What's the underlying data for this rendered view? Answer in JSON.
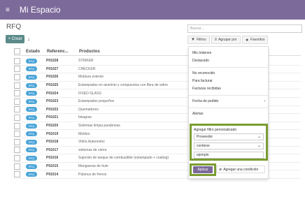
{
  "app": {
    "menu_icon": "≡",
    "title": "Mi Espacio"
  },
  "page": {
    "title": "RFQ"
  },
  "toolbar": {
    "create_label": "+ Crear",
    "download_icon": "↓"
  },
  "search": {
    "placeholder": "Buscar..."
  },
  "filters_bar": {
    "filters_label": "Filtros",
    "group_label": "Agrupar por",
    "favorites_label": "Favoritos"
  },
  "table": {
    "headers": [
      "Estado",
      "Referenc...",
      "Productos"
    ],
    "rows": [
      {
        "estado": "RFQ",
        "ref": "P01028",
        "product": "STRIKER"
      },
      {
        "estado": "RFQ",
        "ref": "P01027",
        "product": "CHECKER"
      },
      {
        "estado": "RFQ",
        "ref": "P01026",
        "product": "Moldura exterior"
      },
      {
        "estado": "RFQ",
        "ref": "P01025",
        "product": "Estampados en aluminio y compuestos con fibra de vidrio"
      },
      {
        "estado": "RFQ",
        "ref": "P01024",
        "product": "FIXED GLASS"
      },
      {
        "estado": "RFQ",
        "ref": "P01023",
        "product": "Estampados pequeños"
      },
      {
        "estado": "RFQ",
        "ref": "P01022",
        "product": "Quemadores"
      },
      {
        "estado": "RFQ",
        "ref": "P01021",
        "product": "bisagras"
      },
      {
        "estado": "RFQ",
        "ref": "P01020",
        "product": "Sistemas limpia parabrisas"
      },
      {
        "estado": "RFQ",
        "ref": "P01019",
        "product": "Moldeo"
      },
      {
        "estado": "RFQ",
        "ref": "P01018",
        "product": "Vidrio Automotriz"
      },
      {
        "estado": "RFQ",
        "ref": "P01017",
        "product": "sistemas de cierre"
      },
      {
        "estado": "RFQ",
        "ref": "P01016",
        "product": "Sujeción de tanque de combustible (estampado + coating)"
      },
      {
        "estado": "RFQ",
        "ref": "P01015",
        "product": "Mangueras de hule"
      },
      {
        "estado": "RFQ",
        "ref": "P01014",
        "product": "Palanca de frenos"
      }
    ]
  },
  "filter_menu": {
    "items": [
      "Mis órdenes",
      "Destacado",
      "No reconocido",
      "Para facturar",
      "Facturas recibidas",
      "Fecha de pedido",
      "Alertas"
    ],
    "custom": {
      "title": "Agregar filtro personalizado",
      "field_value": "Proveedor",
      "operator_value": "contiene",
      "input_value": "ejemplo"
    },
    "apply_label": "Aplicar",
    "add_condition_label": "Agregar una condición"
  },
  "colors": {
    "topbar": "#7c6a9a",
    "badge": "#4aa4d8",
    "highlight": "#7a9c32"
  }
}
